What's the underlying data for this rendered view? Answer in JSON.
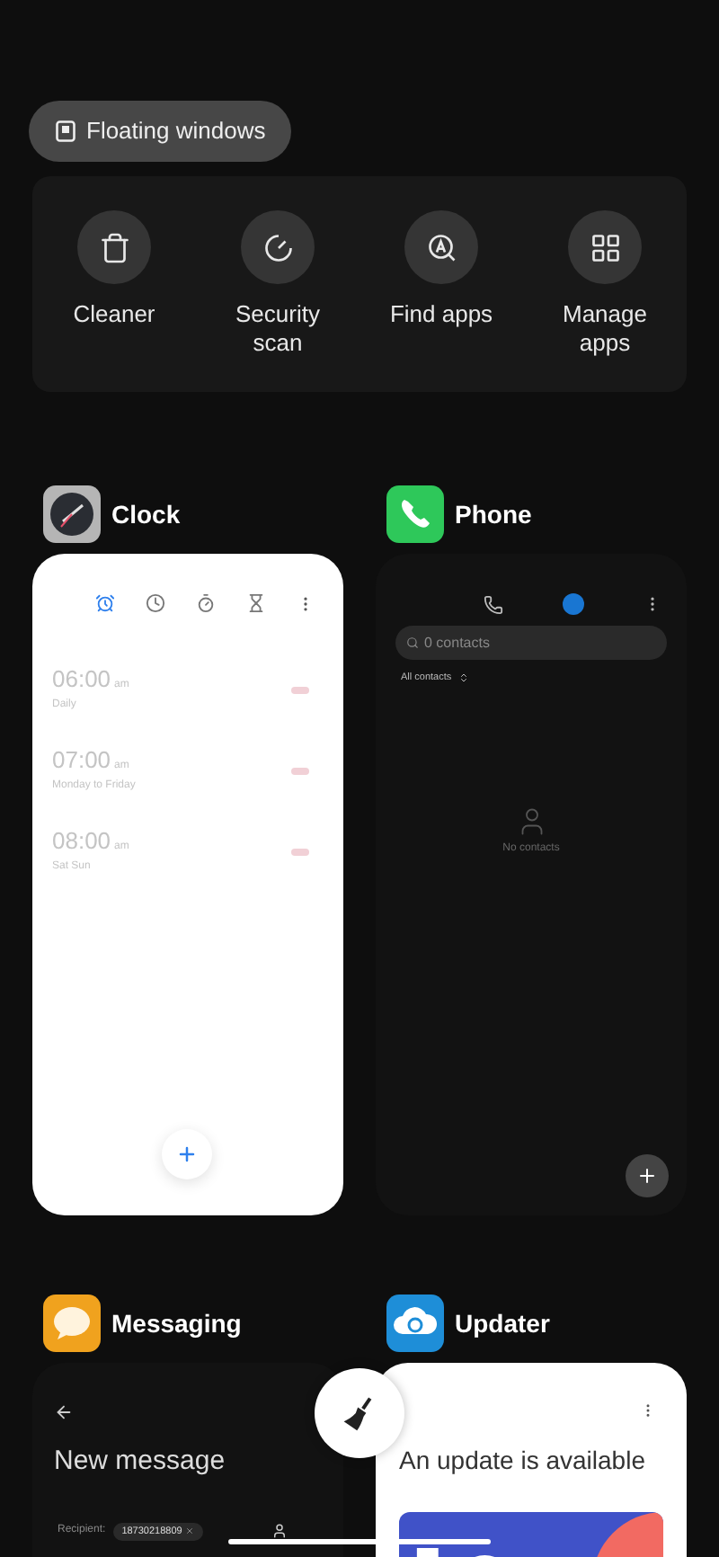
{
  "floating_button": {
    "label": "Floating windows"
  },
  "tools": [
    {
      "kind": "cleaner",
      "label": "Cleaner"
    },
    {
      "kind": "security",
      "label": "Security scan"
    },
    {
      "kind": "find",
      "label": "Find apps"
    },
    {
      "kind": "manage",
      "label": "Manage apps"
    }
  ],
  "apps": [
    {
      "kind": "clock",
      "name": "Clock",
      "tabs": [
        {
          "kind": "alarm",
          "selected": true
        },
        {
          "kind": "clock",
          "selected": false
        },
        {
          "kind": "stopwatch",
          "selected": false
        },
        {
          "kind": "timer",
          "selected": false
        }
      ],
      "alarms": [
        {
          "time": "06:00",
          "period": "am",
          "repeat": "Daily",
          "on": false
        },
        {
          "time": "07:00",
          "period": "am",
          "repeat": "Monday to Friday",
          "on": false
        },
        {
          "time": "08:00",
          "period": "am",
          "repeat": "Sat Sun",
          "on": false
        }
      ]
    },
    {
      "kind": "phone",
      "name": "Phone",
      "tabs": [
        {
          "kind": "calls",
          "selected": false
        },
        {
          "kind": "contacts",
          "selected": true
        }
      ],
      "search": {
        "placeholder": "0 contacts"
      },
      "filter": "All contacts",
      "empty": "No contacts"
    },
    {
      "kind": "messaging",
      "name": "Messaging",
      "title": "New message",
      "recipient_label": "Recipient:",
      "recipient": "18730218809"
    },
    {
      "kind": "updater",
      "name": "Updater",
      "title": "An update is available"
    }
  ]
}
